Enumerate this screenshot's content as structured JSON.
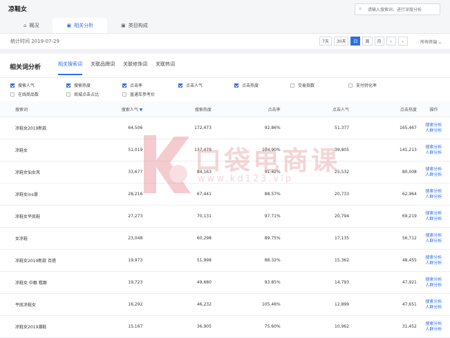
{
  "app": {
    "title": "凉鞋女",
    "search_placeholder": "请输入搜索词，进行深度分析"
  },
  "tabs": [
    {
      "label": "概况",
      "icon": "home-icon"
    },
    {
      "label": "相关分析",
      "icon": "bag-icon",
      "active": true
    },
    {
      "label": "类目构成",
      "icon": "bag-icon"
    }
  ],
  "stats": {
    "time_label": "统计时间 2019-07-29",
    "range_buttons": [
      "7天",
      "30天",
      "日",
      "周",
      "月"
    ],
    "active_range": "日",
    "prev": "‹",
    "next": "›",
    "terminal": "所有终端 ⌄"
  },
  "panel": {
    "title": "相关词分析",
    "subtabs": [
      "相关搜索词",
      "关联品牌词",
      "关联修饰词",
      "关联热词"
    ],
    "active_subtab": 0
  },
  "checkboxes": [
    {
      "label": "搜索人气",
      "checked": true
    },
    {
      "label": "搜索热度",
      "checked": true
    },
    {
      "label": "点击率",
      "checked": true
    },
    {
      "label": "点击人气",
      "checked": true
    },
    {
      "label": "点击热度",
      "checked": true
    },
    {
      "label": "交易指数",
      "checked": false
    },
    {
      "label": "支付转化率",
      "checked": false
    },
    {
      "label": "在线商品数",
      "checked": false
    },
    {
      "label": "商城点击占比",
      "checked": false
    },
    {
      "label": "直通车参考价",
      "checked": false
    }
  ],
  "table": {
    "headers": [
      "搜索词",
      "搜索人气",
      "搜索热度",
      "点击率",
      "点击人气",
      "点击热度",
      "操作"
    ],
    "sort_indicator": "▼",
    "op_links": [
      "搜索分析",
      "人群分析"
    ],
    "rows": [
      [
        "凉鞋女2019新款",
        "64,506",
        "172,473",
        "92.86%",
        "51,377",
        "165,467"
      ],
      [
        "凉鞋女",
        "51,019",
        "137,479",
        "104.90%",
        "39,805",
        "141,213"
      ],
      [
        "凉鞋女仙女风",
        "33,677",
        "84,163",
        "91.42%",
        "25,532",
        "80,008"
      ],
      [
        "凉鞋女ins潮",
        "28,216",
        "67,441",
        "88.57%",
        "20,733",
        "62,964"
      ],
      [
        "凉鞋女平底鞋",
        "27,273",
        "70,131",
        "97.71%",
        "20,794",
        "69,219"
      ],
      [
        "女凉鞋",
        "23,048",
        "60,298",
        "89.75%",
        "17,135",
        "56,712"
      ],
      [
        "凉鞋女2019新款 百搭",
        "19,973",
        "51,998",
        "88.32%",
        "15,362",
        "48,455"
      ],
      [
        "凉鞋女 中跟 粗跟",
        "19,723",
        "49,680",
        "93.85%",
        "14,793",
        "47,921"
      ],
      [
        "平底凉鞋女",
        "16,292",
        "46,232",
        "105.46%",
        "12,899",
        "47,651"
      ],
      [
        "凉鞋女2019潮鞋",
        "15,167",
        "36,905",
        "75.60%",
        "10,962",
        "31,452"
      ]
    ]
  },
  "watermark": {
    "text": "口袋电商课",
    "url": "www.kd123.vip"
  }
}
